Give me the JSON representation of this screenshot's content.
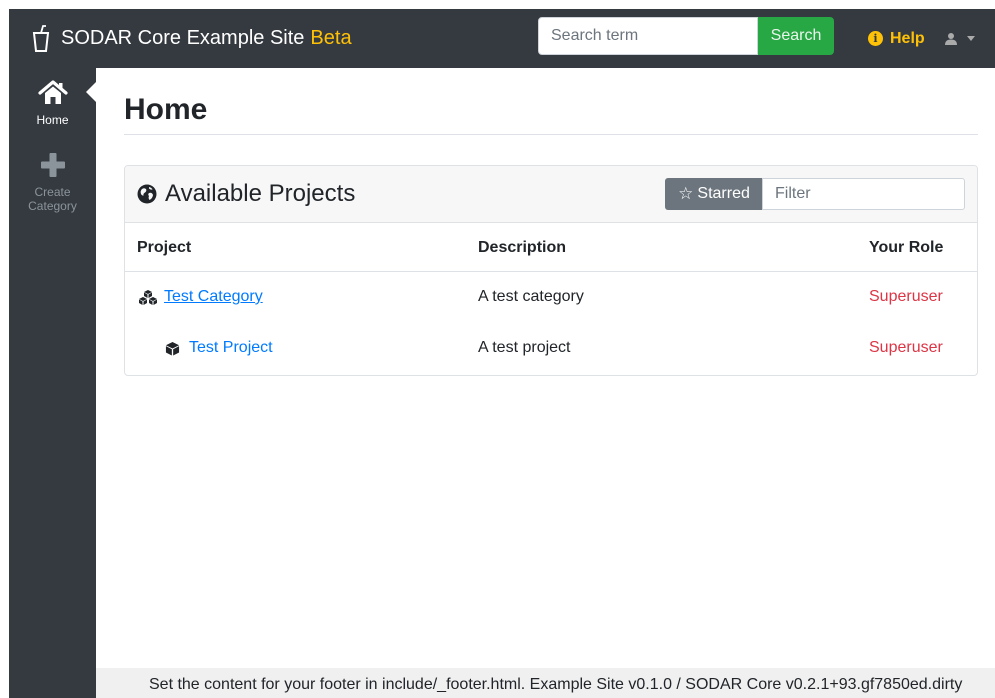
{
  "navbar": {
    "brand_name": "SODAR Core Example Site",
    "brand_badge": "Beta",
    "search_placeholder": "Search term",
    "search_button": "Search",
    "help_label": "Help",
    "help_icon": "info-circle-icon",
    "user_icon": "user-icon"
  },
  "sidebar": {
    "items": [
      {
        "label": "Home",
        "icon": "home-icon",
        "active": true
      },
      {
        "label": "Create Category",
        "icon": "plus-icon",
        "active": false
      }
    ]
  },
  "main": {
    "page_title": "Home",
    "card": {
      "title": "Available Projects",
      "title_icon": "globe-icon",
      "starred_label": "Starred",
      "filter_placeholder": "Filter",
      "columns": [
        "Project",
        "Description",
        "Your Role"
      ],
      "rows": [
        {
          "name": "Test Category",
          "type_icon": "cubes-icon",
          "description": "A test category",
          "role": "Superuser"
        },
        {
          "name": "Test Project",
          "type_icon": "cube-icon",
          "description": "A test project",
          "role": "Superuser"
        }
      ]
    }
  },
  "footer": {
    "text": "Set the content for your footer in include/_footer.html. Example Site v0.1.0 / SODAR Core v0.2.1+93.gf7850ed.dirty"
  },
  "colors": {
    "navbar_bg": "#343a40",
    "brand_badge": "#ffc107",
    "search_button": "#28a745",
    "link": "#007bff",
    "role": "#dc3545"
  }
}
